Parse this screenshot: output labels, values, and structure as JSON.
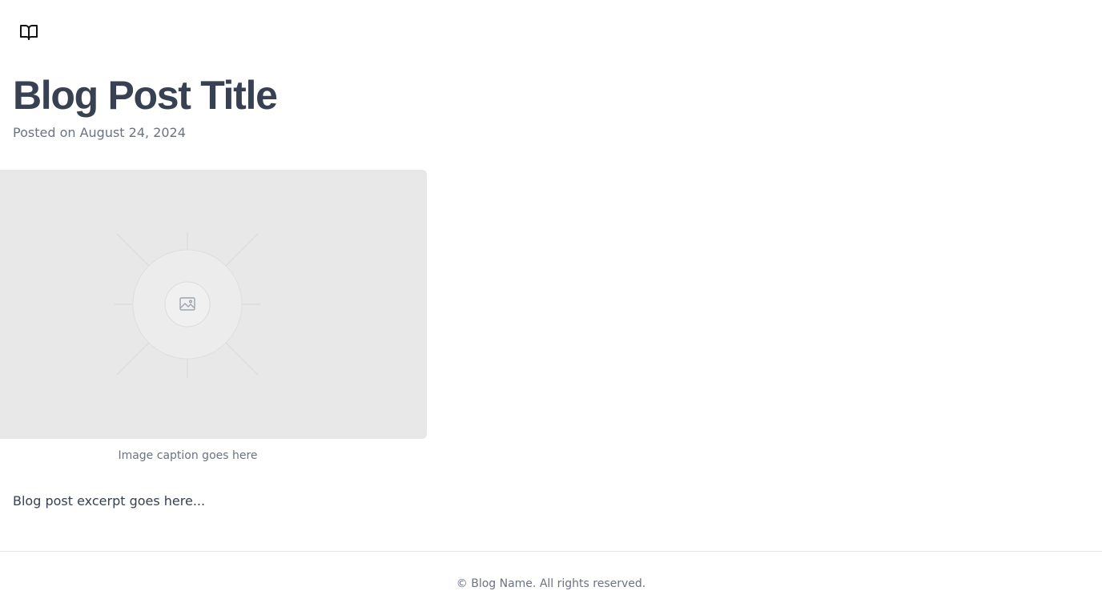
{
  "header": {
    "logo_icon": "open-book-icon"
  },
  "post": {
    "title": "Blog Post Title",
    "posted": "Posted on August 24, 2024",
    "image_icon": "image-placeholder-icon",
    "caption": "Image caption goes here",
    "excerpt": "Blog post excerpt goes here..."
  },
  "footer": {
    "copyright": "© Blog Name. All rights reserved."
  },
  "colors": {
    "title": "#374151",
    "muted": "#6b7280",
    "placeholder_bg": "#e8e8e8",
    "divider": "#e5e7eb"
  }
}
